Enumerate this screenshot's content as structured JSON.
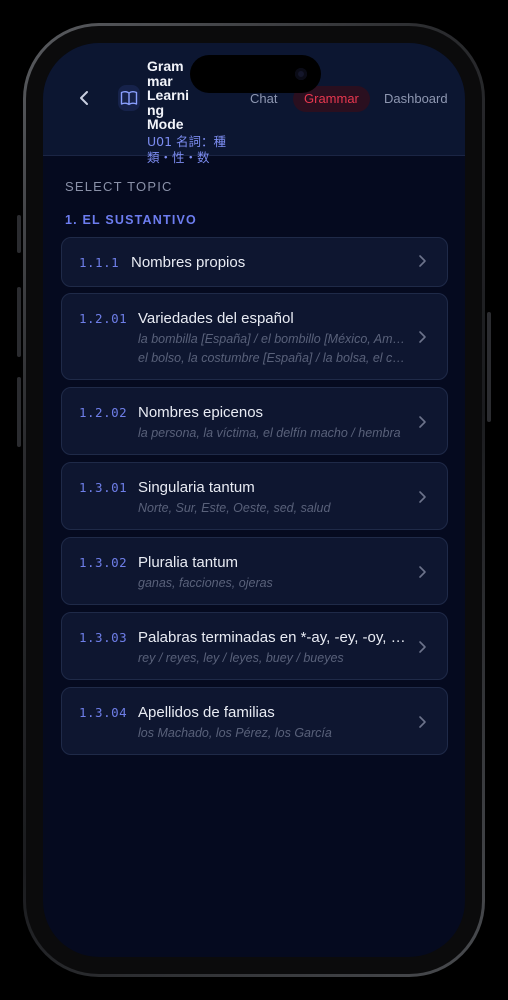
{
  "header": {
    "back_icon": "chevron-left-icon",
    "book_icon": "open-book-icon",
    "title": "Grammar Learning Mode",
    "subtitle": "U01 名詞：種類・性・数",
    "tabs": [
      {
        "label": "Chat",
        "active": false
      },
      {
        "label": "Grammar",
        "active": true
      },
      {
        "label": "Dashboard",
        "active": false
      }
    ]
  },
  "main": {
    "section_label": "SELECT TOPIC",
    "group_label": "1. EL SUSTANTIVO",
    "topics": [
      {
        "num": "1.1.1",
        "name": "Nombres propios",
        "examples": []
      },
      {
        "num": "1.2.01",
        "name": "Variedades del español",
        "examples": [
          "la bombilla [España] / el bombillo [México, América Central]",
          "el bolso, la costumbre [España] / la bolsa, el costume"
        ]
      },
      {
        "num": "1.2.02",
        "name": "Nombres epicenos",
        "examples": [
          "la persona, la víctima, el delfín macho / hembra"
        ]
      },
      {
        "num": "1.3.01",
        "name": "Singularia tantum",
        "examples": [
          "Norte, Sur, Este, Oeste, sed, salud"
        ]
      },
      {
        "num": "1.3.02",
        "name": "Pluralia tantum",
        "examples": [
          "ganas, facciones, ojeras"
        ]
      },
      {
        "num": "1.3.03",
        "name": "Palabras terminadas en *-ay, -ey, -oy, -uy",
        "examples": [
          "rey / reyes, ley / leyes, buey / bueyes"
        ]
      },
      {
        "num": "1.3.04",
        "name": "Apellidos de familias",
        "examples": [
          "los Machado, los Pérez, los García"
        ]
      }
    ]
  },
  "colors": {
    "background": "#050a1f",
    "header": "#0c1631",
    "accent": "#6d7df0",
    "active_tab": "#e6374f"
  }
}
